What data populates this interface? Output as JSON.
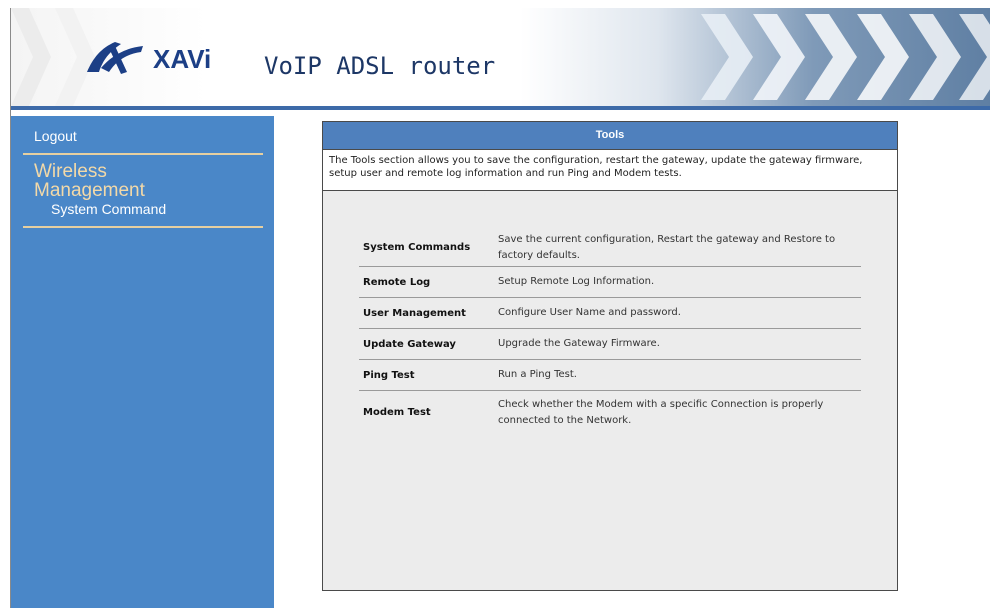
{
  "header": {
    "brand": "XAVi",
    "title": "VoIP ADSL router"
  },
  "sidebar": {
    "logout": "Logout",
    "section_line1": "Wireless",
    "section_line2": "Management",
    "sub_item": "System Command"
  },
  "panel": {
    "title": "Tools",
    "description": "The Tools section allows you to save the configuration, restart the gateway, update the gateway firmware, setup user and remote log information and run Ping and Modem tests.",
    "rows": [
      {
        "name": "System Commands",
        "desc": "Save the current configuration, Restart the gateway and Restore to factory defaults."
      },
      {
        "name": "Remote Log",
        "desc": "Setup Remote Log Information."
      },
      {
        "name": "User Management",
        "desc": "Configure User Name and password."
      },
      {
        "name": "Update Gateway",
        "desc": "Upgrade the Gateway Firmware."
      },
      {
        "name": "Ping Test",
        "desc": "Run a Ping Test."
      },
      {
        "name": "Modem Test",
        "desc": "Check whether the Modem with a specific Connection is properly connected to the Network."
      }
    ]
  },
  "colors": {
    "sidebar_bg": "#4a87c8",
    "header_accent": "#3d6aa8",
    "panel_header": "#4f80bd",
    "separator": "#e6cfa0",
    "section_text": "#f3d9a8"
  }
}
